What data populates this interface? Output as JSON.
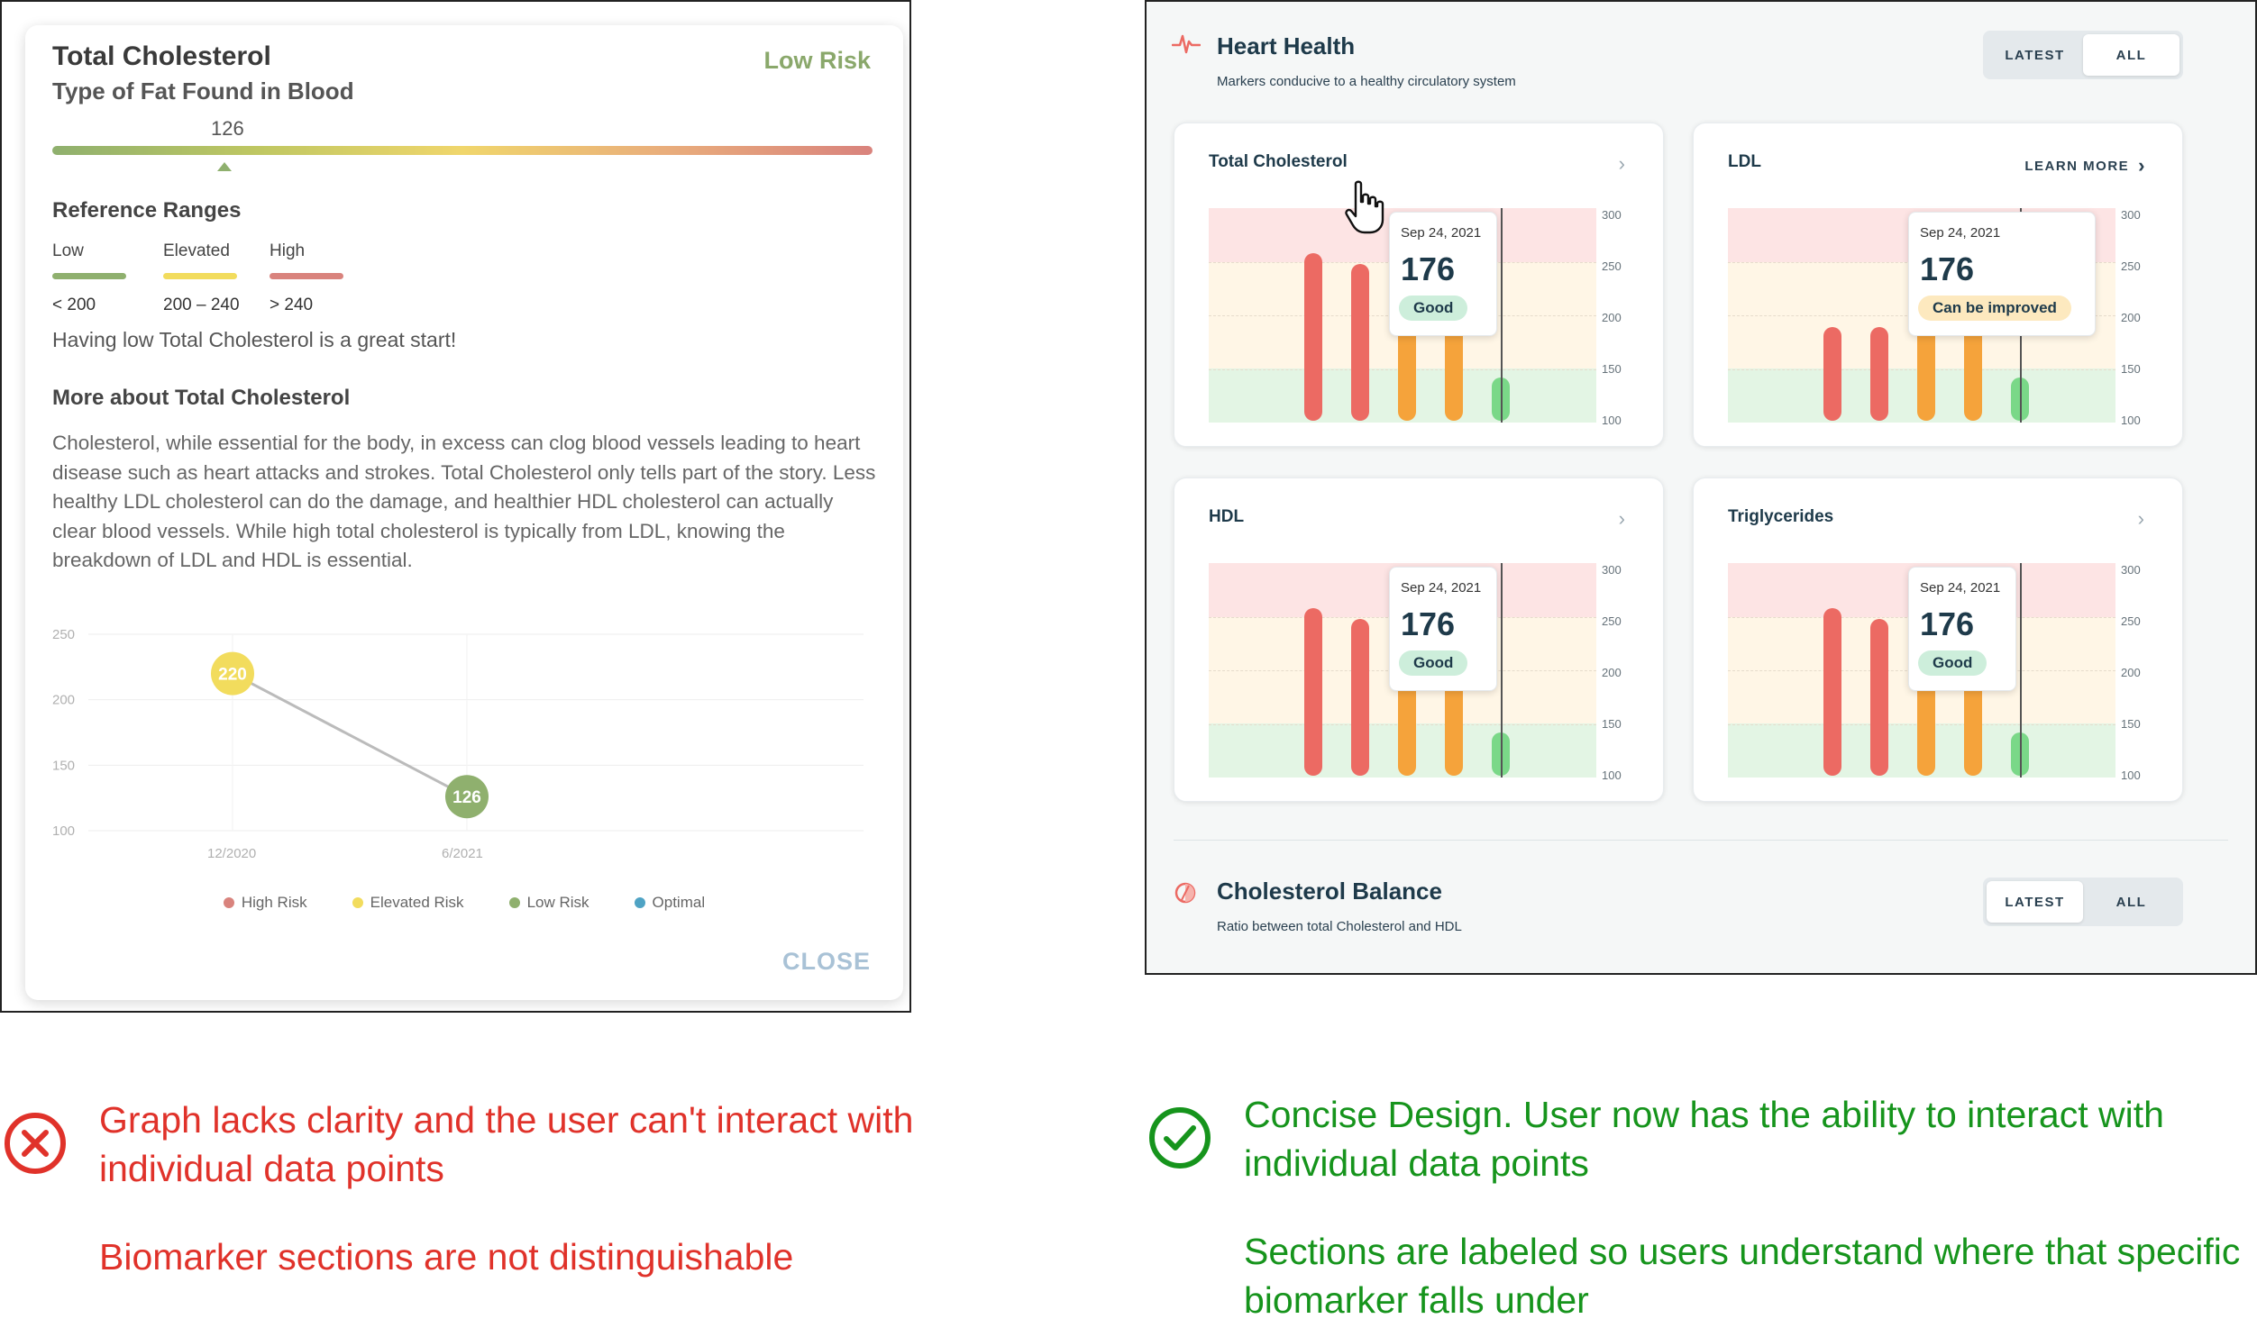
{
  "old_design": {
    "title": "Total Cholesterol",
    "subtitle": "Type of Fat Found in Blood",
    "risk_status": "Low Risk",
    "current_value": "126",
    "reference_heading": "Reference Ranges",
    "ranges": [
      {
        "label": "Low",
        "range": "< 200",
        "color": "#8fb06e"
      },
      {
        "label": "Elevated",
        "range": "200 – 240",
        "color": "#f2dc5d"
      },
      {
        "label": "High",
        "range": "> 240",
        "color": "#d9837d"
      }
    ],
    "summary": "Having low Total Cholesterol is a great start!",
    "more_heading": "More about Total Cholesterol",
    "body": "Cholesterol, while essential for the body, in excess can clog blood vessels leading to heart disease such as heart attacks and strokes. Total Cholesterol only tells part of the story. Less healthy LDL cholesterol can do the damage, and healthier HDL cholesterol can actually clear blood vessels. While high total cholesterol is typically from LDL, knowing the breakdown of LDL and HDL is essential.",
    "legend": [
      {
        "label": "High Risk",
        "color": "#d9837d"
      },
      {
        "label": "Elevated Risk",
        "color": "#f2dc5d"
      },
      {
        "label": "Low Risk",
        "color": "#8fb06e"
      },
      {
        "label": "Optimal",
        "color": "#4fa3c4"
      }
    ],
    "close_label": "CLOSE"
  },
  "new_design": {
    "section_title": "Heart Health",
    "section_subtitle": "Markers conducive to a healthy circulatory system",
    "toggle": {
      "latest": "LATEST",
      "all": "ALL"
    },
    "learn_more": "LEARN MORE",
    "yticks": [
      "300",
      "250",
      "200",
      "150",
      "100"
    ],
    "cards": [
      {
        "title": "Total Cholesterol",
        "date": "Sep 24, 2021",
        "value": "176",
        "badge": "Good",
        "badge_type": "good"
      },
      {
        "title": "LDL",
        "date": "Sep 24, 2021",
        "value": "176",
        "badge": "Can be improved",
        "badge_type": "improve"
      },
      {
        "title": "HDL",
        "date": "Sep 24, 2021",
        "value": "176",
        "badge": "Good",
        "badge_type": "good"
      },
      {
        "title": "Triglycerides",
        "date": "Sep 24, 2021",
        "value": "176",
        "badge": "Good",
        "badge_type": "good"
      }
    ],
    "balance_title": "Cholesterol Balance",
    "balance_subtitle": "Ratio between total Cholesterol and HDL"
  },
  "captions": {
    "bad_1": "Graph lacks clarity and the user can't interact with individual data points",
    "bad_2": "Biomarker sections are not distinguishable",
    "good_1": "Concise Design. User now has the ability to interact with individual data points",
    "good_2": "Sections are labeled so users understand where that specific biomarker falls under"
  },
  "chart_data": {
    "type": "line",
    "x": [
      "12/2020",
      "6/2021"
    ],
    "series": [
      {
        "values": [
          220,
          126
        ],
        "point_colors": [
          "#f2dc5d",
          "#8fb06e"
        ]
      }
    ],
    "yticks": [
      250,
      200,
      150,
      100
    ],
    "ylim": [
      100,
      250
    ],
    "grid": true,
    "legend": "bottom"
  }
}
